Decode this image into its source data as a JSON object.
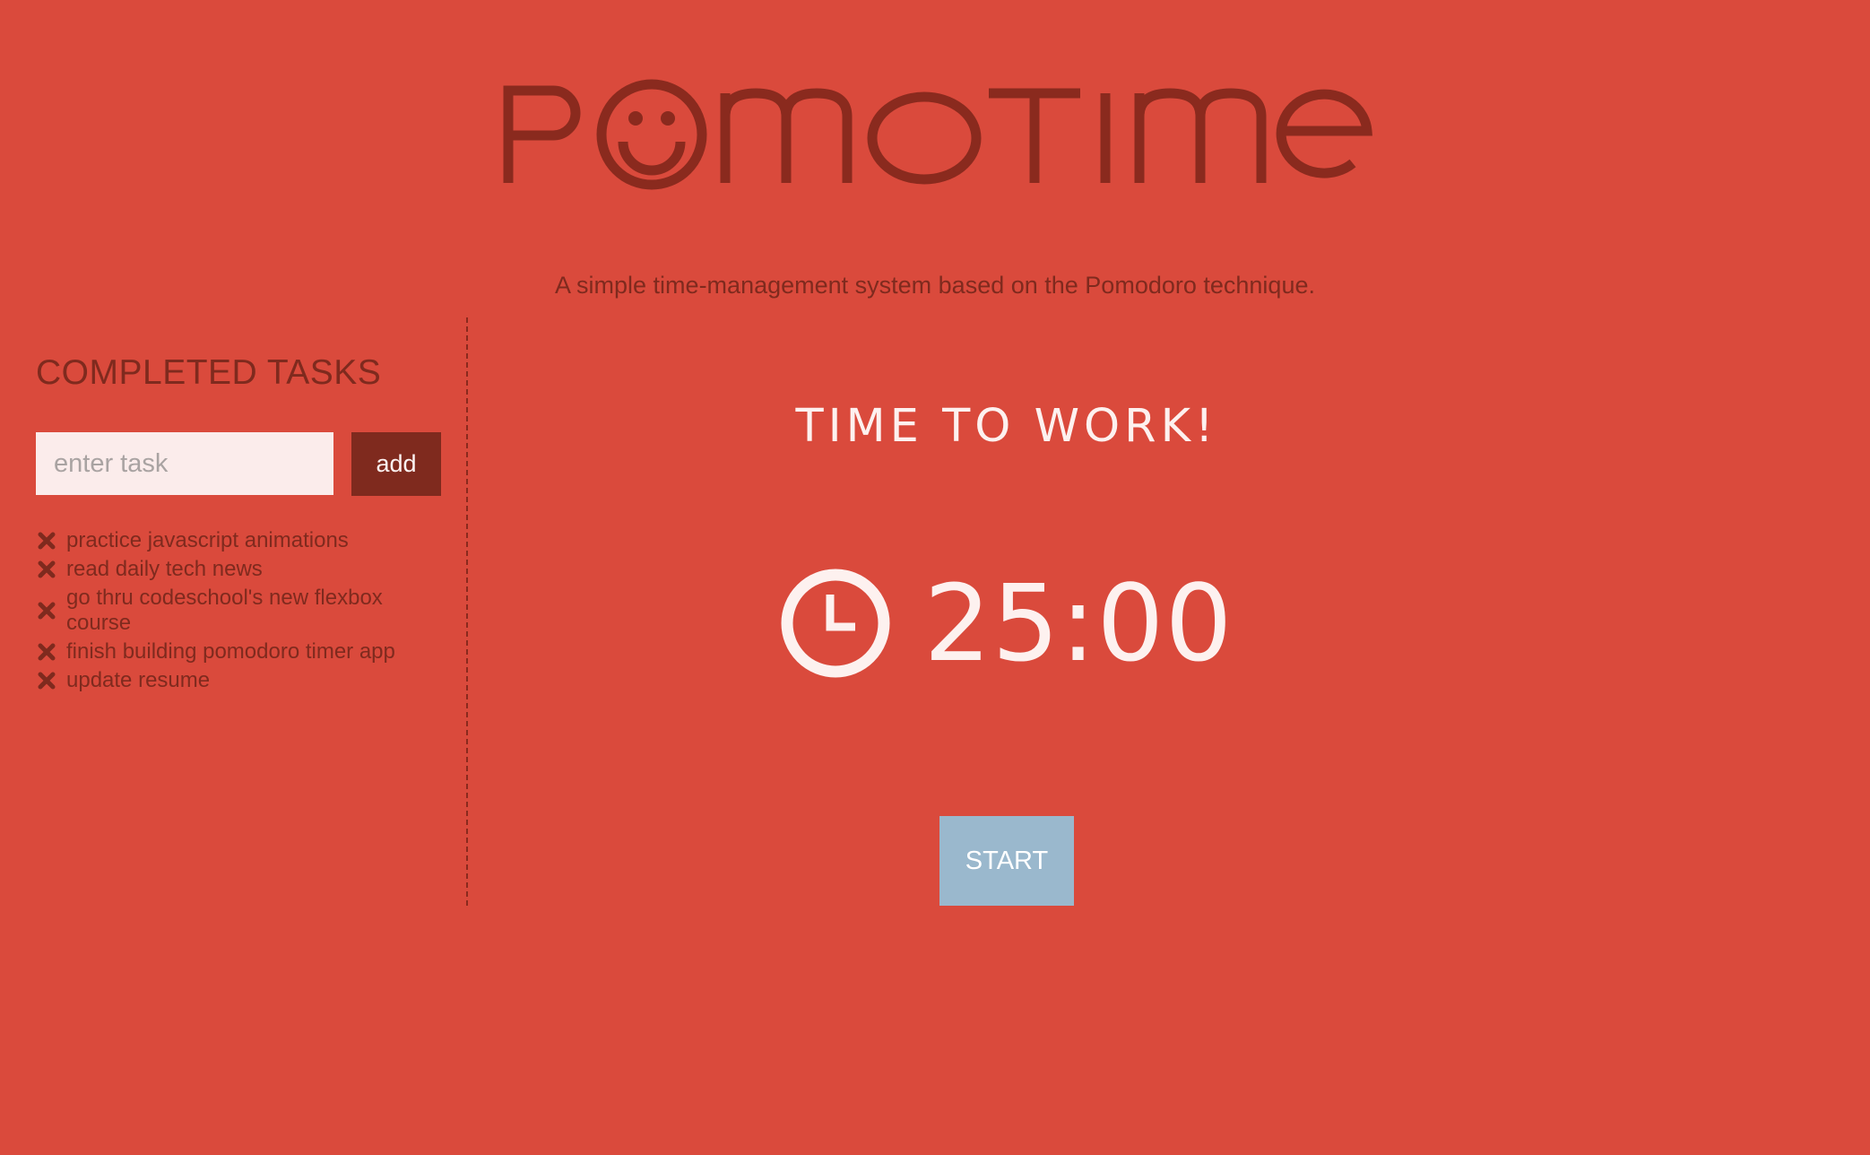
{
  "app": {
    "name": "PomoTime",
    "tagline": "A simple time-management system based on the Pomodoro technique."
  },
  "colors": {
    "background": "#da4a3c",
    "accent_dark": "#7f2a1e",
    "light_text": "#fdf1ef",
    "start_button": "#9ab8cd"
  },
  "sidebar": {
    "heading": "COMPLETED TASKS",
    "input_placeholder": "enter task",
    "input_value": "",
    "add_label": "add",
    "tasks": [
      {
        "label": "practice javascript animations",
        "icon": "remove-x-icon"
      },
      {
        "label": "read daily tech news",
        "icon": "remove-x-icon"
      },
      {
        "label": "go thru codeschool's new flexbox course",
        "icon": "remove-x-icon"
      },
      {
        "label": "finish building pomodoro timer app",
        "icon": "remove-x-icon"
      },
      {
        "label": "update resume",
        "icon": "remove-x-icon"
      }
    ]
  },
  "timer": {
    "mode_title": "TIME TO WORK!",
    "time": "25:00",
    "icon": "clock-icon",
    "start_label": "START"
  }
}
